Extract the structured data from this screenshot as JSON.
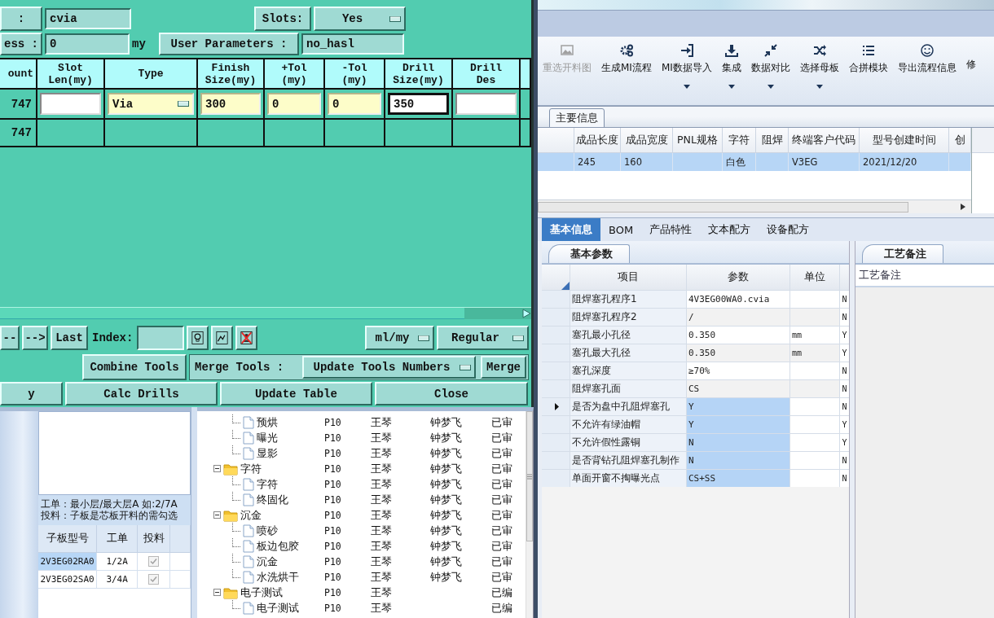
{
  "drill_dialog": {
    "name_label": ":",
    "name_value": "cvia",
    "slots_label": "Slots:",
    "slots_value": "Yes",
    "thickness_label": "ess :",
    "thickness_value": "0",
    "thickness_unit": "my",
    "user_params_button": "User Parameters :",
    "user_params_value": "no_hasl",
    "columns": [
      "ount",
      "Slot\nLen(my)",
      "Type",
      "Finish\nSize(my)",
      "+Tol\n(my)",
      "-Tol\n(my)",
      "Drill\nSize(my)",
      "Drill\nDes"
    ],
    "rows": [
      {
        "count": "747",
        "cells": [
          {
            "kind": "input"
          },
          {
            "kind": "select",
            "value": "Via"
          },
          {
            "kind": "required",
            "value": "300"
          },
          {
            "kind": "required",
            "value": "0"
          },
          {
            "kind": "required",
            "value": "0"
          },
          {
            "kind": "focused",
            "value": "350"
          },
          {
            "kind": "input"
          }
        ]
      },
      {
        "count": "747"
      }
    ],
    "nav_buttons": [
      "--",
      "-->",
      "Last"
    ],
    "index_label": "Index:",
    "unit_select": "ml/my",
    "mode_select": "Regular",
    "combine_button": "Combine Tools",
    "merge_label": "Merge Tools :",
    "merge_select": "Update Tools Numbers",
    "merge_button": "Merge",
    "bottom_buttons": [
      "y",
      "Calc Drills",
      "Update Table",
      "Close"
    ]
  },
  "app": {
    "ribbon": [
      {
        "label": "重选开料图",
        "disabled": true,
        "dropdown": false
      },
      {
        "label": "生成MI流程",
        "disabled": false,
        "dropdown": false
      },
      {
        "label": "MI数据导入",
        "disabled": false,
        "dropdown": true
      },
      {
        "label": "集成",
        "disabled": false,
        "dropdown": true
      },
      {
        "label": "数据对比",
        "disabled": false,
        "dropdown": true
      },
      {
        "label": "选择母板",
        "disabled": false,
        "dropdown": true
      },
      {
        "label": "合拼模块",
        "disabled": false,
        "dropdown": false
      },
      {
        "label": "导出流程信息",
        "disabled": false,
        "dropdown": false
      },
      {
        "label": "修",
        "disabled": false,
        "dropdown": false
      }
    ],
    "main_tab": "主要信息",
    "main_table": {
      "columns": [
        null,
        "成品长度",
        "成品宽度",
        "PNL规格",
        "字符",
        "阻焊",
        "终端客户代码",
        "型号创建时间",
        "创"
      ],
      "rows": [
        {
          "selected": true,
          "cells": [
            null,
            "245",
            "160",
            null,
            "白色",
            null,
            "V3EG",
            "2021/12/20",
            null
          ]
        }
      ]
    },
    "detail_tabs": [
      {
        "label": "基本信息",
        "selected": true
      },
      {
        "label": "BOM",
        "selected": false
      },
      {
        "label": "产品特性",
        "selected": false
      },
      {
        "label": "文本配方",
        "selected": false
      },
      {
        "label": "设备配方",
        "selected": false
      }
    ],
    "params": {
      "tab": "基本参数",
      "columns": [
        "项目",
        "参数",
        "单位"
      ],
      "rows": [
        {
          "item": "阻焊塞孔程序1",
          "value": "4V3EG00WA0.cvia",
          "unit": null,
          "flag": "N",
          "selected": false,
          "current": false
        },
        {
          "item": "阻焊塞孔程序2",
          "value": "/",
          "unit": null,
          "flag": "N",
          "selected": false,
          "current": false
        },
        {
          "item": "塞孔最小孔径",
          "value": "0.350",
          "unit": "mm",
          "flag": "Y",
          "selected": false,
          "current": false
        },
        {
          "item": "塞孔最大孔径",
          "value": "0.350",
          "unit": "mm",
          "flag": "Y",
          "selected": false,
          "current": false
        },
        {
          "item": "塞孔深度",
          "value": "≥70%",
          "unit": null,
          "flag": "N",
          "selected": false,
          "current": false
        },
        {
          "item": "阻焊塞孔面",
          "value": "CS",
          "unit": null,
          "flag": "N",
          "selected": false,
          "current": false
        },
        {
          "item": "是否为盘中孔阻焊塞孔",
          "value": "Y",
          "unit": null,
          "flag": "N",
          "selected": true,
          "current": true
        },
        {
          "item": "不允许有绿油帽",
          "value": "Y",
          "unit": null,
          "flag": "Y",
          "selected": true,
          "current": false
        },
        {
          "item": "不允许假性露铜",
          "value": "N",
          "unit": null,
          "flag": "Y",
          "selected": true,
          "current": false
        },
        {
          "item": "是否背钻孔阻焊塞孔制作",
          "value": "N",
          "unit": null,
          "flag": "N",
          "selected": true,
          "current": false
        },
        {
          "item": "单面开窗不掏曝光点",
          "value": "CS+SS",
          "unit": null,
          "flag": "N",
          "selected": true,
          "current": false
        }
      ]
    },
    "notes": {
      "tab": "工艺备注",
      "header": "工艺备注"
    }
  },
  "suborder_panel": {
    "hint_lines": [
      "工单：最小层/最大层A 如:2/7A",
      "投料：子板是芯板开料的需勾选"
    ],
    "columns": [
      "子板型号",
      "工单",
      "投料"
    ],
    "rows": [
      {
        "model": "2V3EG02RA0",
        "order": "1/2A",
        "feed": true,
        "selected": true
      },
      {
        "model": "2V3EG02SA0",
        "order": "3/4A",
        "feed": true,
        "selected": false
      }
    ]
  },
  "process_tree": [
    {
      "children": [
        {
          "label": "预烘",
          "code": "P10",
          "maker": "王琴",
          "checker": "钟梦飞",
          "status": "已审"
        },
        {
          "label": "曝光",
          "code": "P10",
          "maker": "王琴",
          "checker": "钟梦飞",
          "status": "已审"
        },
        {
          "label": "显影",
          "code": "P10",
          "maker": "王琴",
          "checker": "钟梦飞",
          "status": "已审"
        }
      ]
    },
    {
      "label": "字符",
      "code": "P10",
      "maker": "王琴",
      "checker": "钟梦飞",
      "status": "已审",
      "expanded": true,
      "children": [
        {
          "label": "字符",
          "code": "P10",
          "maker": "王琴",
          "checker": "钟梦飞",
          "status": "已审"
        },
        {
          "label": "终固化",
          "code": "P10",
          "maker": "王琴",
          "checker": "钟梦飞",
          "status": "已审"
        }
      ]
    },
    {
      "label": "沉金",
      "code": "P10",
      "maker": "王琴",
      "checker": "钟梦飞",
      "status": "已审",
      "expanded": true,
      "children": [
        {
          "label": "喷砂",
          "code": "P10",
          "maker": "王琴",
          "checker": "钟梦飞",
          "status": "已审"
        },
        {
          "label": "板边包胶",
          "code": "P10",
          "maker": "王琴",
          "checker": "钟梦飞",
          "status": "已审"
        },
        {
          "label": "沉金",
          "code": "P10",
          "maker": "王琴",
          "checker": "钟梦飞",
          "status": "已审"
        },
        {
          "label": "水洗烘干",
          "code": "P10",
          "maker": "王琴",
          "checker": "钟梦飞",
          "status": "已审"
        }
      ]
    },
    {
      "label": "电子测试",
      "code": "P10",
      "maker": "王琴",
      "status": "已编",
      "expanded": true,
      "children": [
        {
          "label": "电子测试",
          "code": "P10",
          "maker": "王琴",
          "status": "已编"
        }
      ]
    }
  ]
}
